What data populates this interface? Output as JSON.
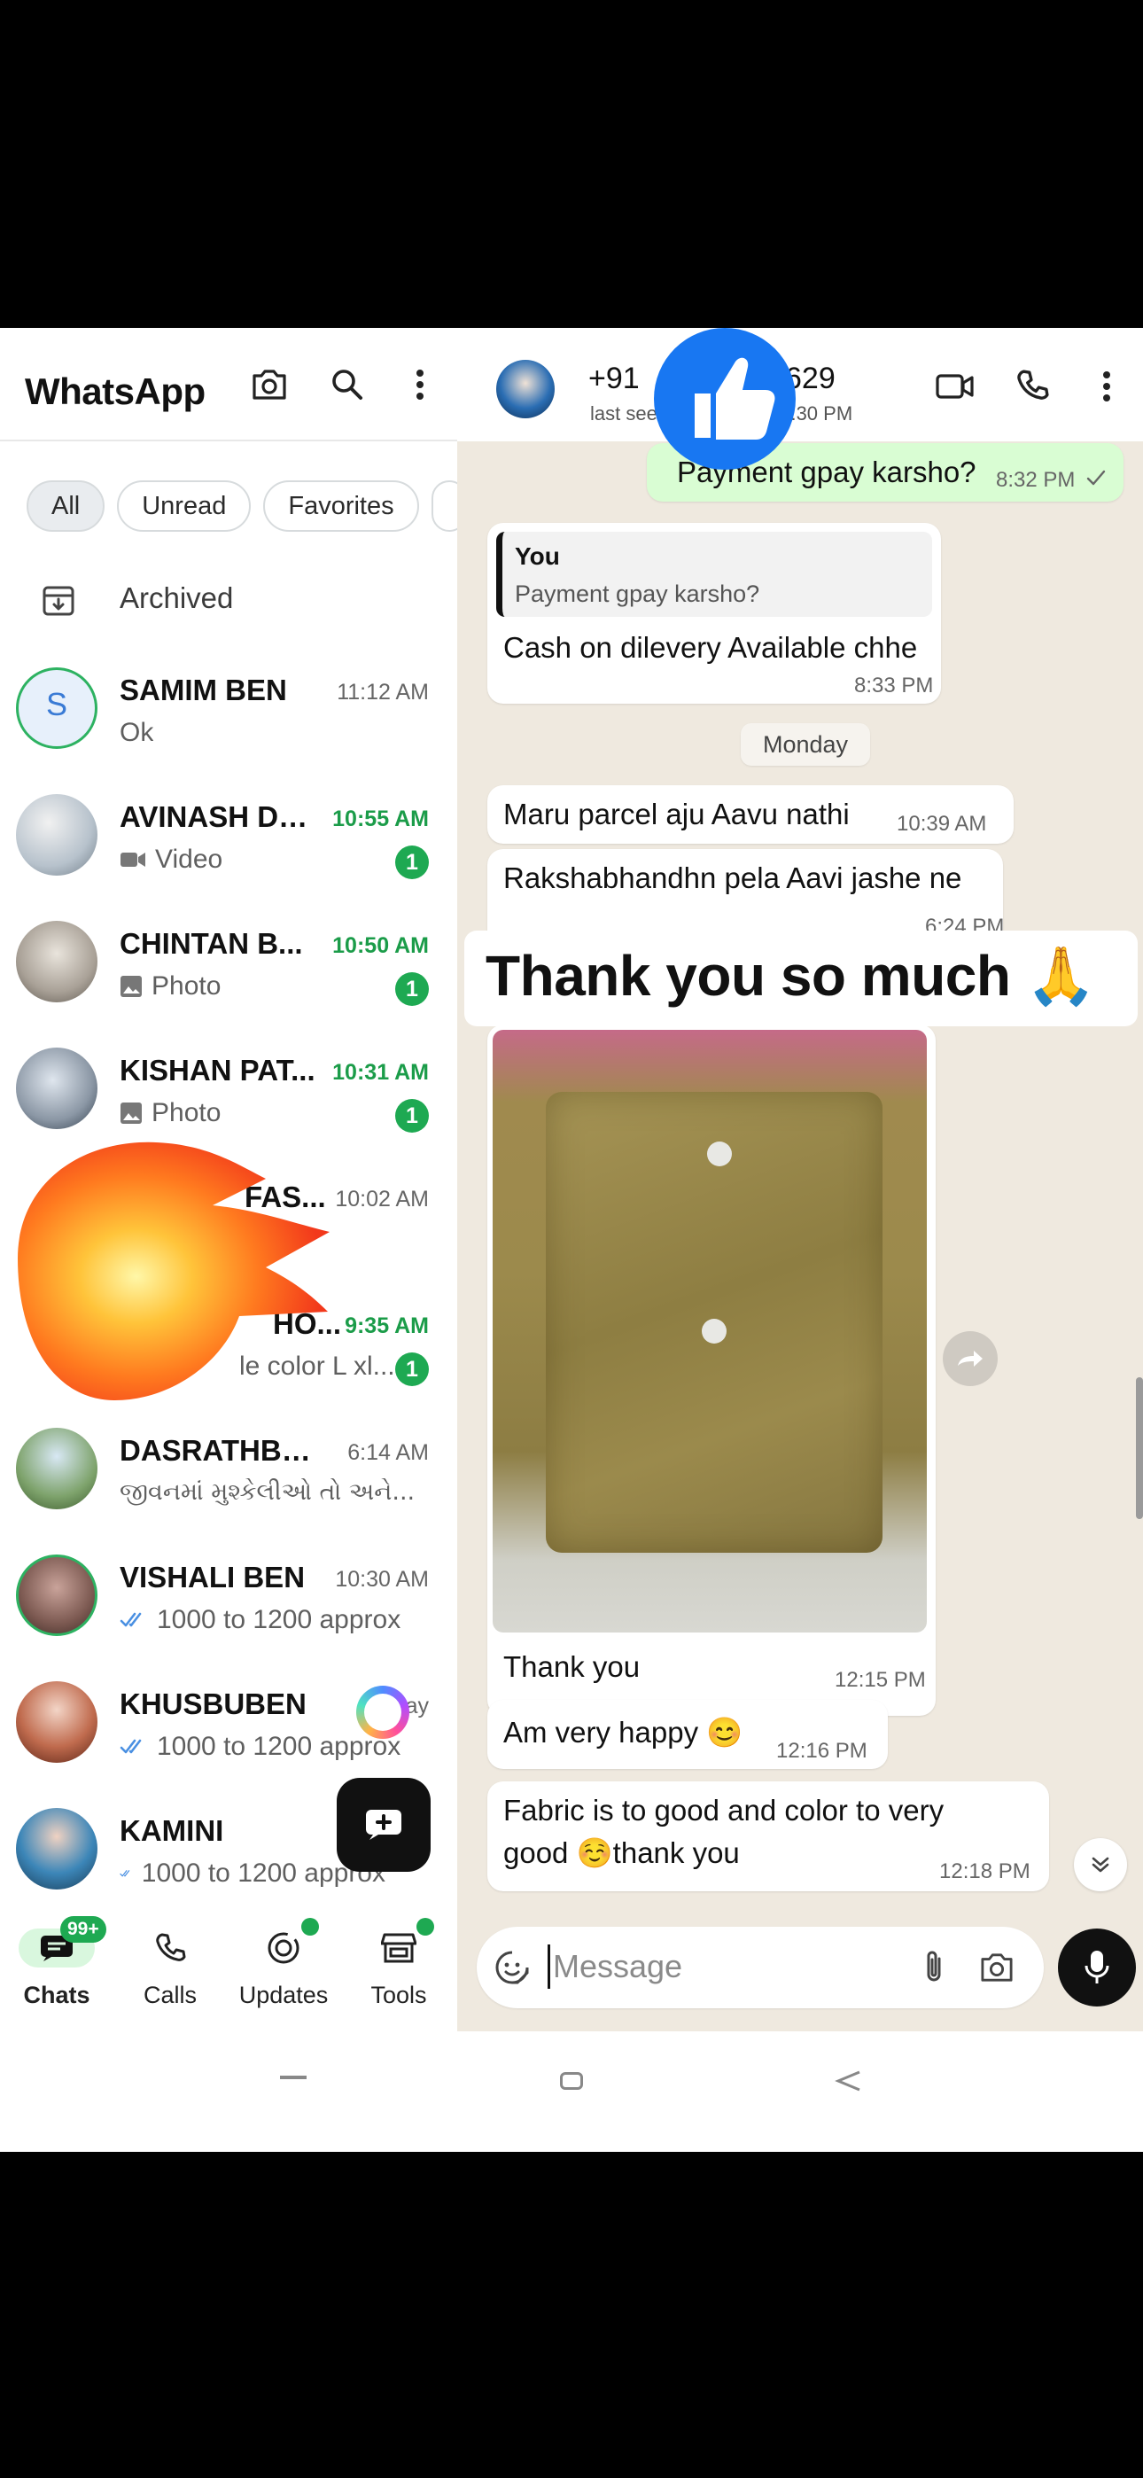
{
  "left": {
    "app_title": "WhatsApp",
    "filters": [
      "All",
      "Unread",
      "Favorites"
    ],
    "archived_label": "Archived",
    "chats": [
      {
        "name": "SAMIM BEN",
        "time": "11:12 AM",
        "preview": "Ok",
        "unread": "",
        "avatar": "letter",
        "letter": "S"
      },
      {
        "name": "AVINASH DR...",
        "time": "10:55 AM",
        "preview": "Video",
        "unread": "1",
        "avatar": "photo"
      },
      {
        "name": "CHINTAN B...",
        "time": "10:50 AM",
        "preview": "Photo",
        "unread": "1",
        "avatar": "photo"
      },
      {
        "name": "KISHAN PAT...",
        "time": "10:31 AM",
        "preview": "Photo",
        "unread": "1",
        "avatar": "photo"
      },
      {
        "name": "FAS...",
        "time": "10:02 AM",
        "preview": "",
        "unread": "",
        "avatar": "hidden"
      },
      {
        "name": "HO...",
        "time": "9:35 AM",
        "preview": "le color L xl...",
        "unread": "1",
        "avatar": "hidden"
      },
      {
        "name": "DASRATHBHAI",
        "time": "6:14 AM",
        "preview": "જીવનમાં મુશ્કેલીઓ તો અને...",
        "unread": "",
        "avatar": "photo"
      },
      {
        "name": "VISHALI BEN",
        "time": "10:30 AM",
        "preview": "1000 to 1200 approx",
        "unread": "",
        "avatar": "photo"
      },
      {
        "name": "KHUSBUBEN",
        "time": "Ye...ay",
        "preview": "1000 to 1200 approx",
        "unread": "",
        "avatar": "photo"
      },
      {
        "name": "KAMINI",
        "time": "",
        "preview": "1000 to 1200 approx",
        "unread": "",
        "avatar": "photo"
      }
    ],
    "nav": [
      {
        "label": "Chats",
        "badge": "99+"
      },
      {
        "label": "Calls",
        "badge": ""
      },
      {
        "label": "Updates",
        "badge": "dot"
      },
      {
        "label": "Tools",
        "badge": "dot"
      }
    ]
  },
  "right": {
    "contact_prefix": "+91",
    "contact_suffix": "629",
    "last_seen_prefix": "last seen",
    "last_seen_time": "t 9:30 PM",
    "messages": {
      "m1_text": "Payment gpay karsho?",
      "m1_time": "8:32 PM",
      "reply_author": "You",
      "reply_quote": "Payment gpay karsho?",
      "m2_text": "Cash on dilevery Available chhe",
      "m2_time": "8:33 PM",
      "date_chip": "Monday",
      "m3_text": "Maru parcel aju Aavu nathi",
      "m3_time": "10:39 AM",
      "m4_text": "Rakshabhandhn pela Aavi jashe ne",
      "m4_time": "6:24 PM",
      "m5_caption": "Thank you",
      "m5_time": "12:15 PM",
      "m6_text": "Am very happy 😊",
      "m6_time": "12:16 PM",
      "m7_line1": "Fabric is to good and color to very",
      "m7_line2": "good ☺️thank you",
      "m7_time": "12:18 PM"
    },
    "composer_placeholder": "Message"
  },
  "overlay": {
    "big_caption": "Thank you so much 🙏"
  },
  "colors": {
    "accent_green": "#1ea952",
    "outgoing_bubble": "#d9fdd3",
    "chat_bg": "#efe9df",
    "like_blue": "#1877f2"
  }
}
